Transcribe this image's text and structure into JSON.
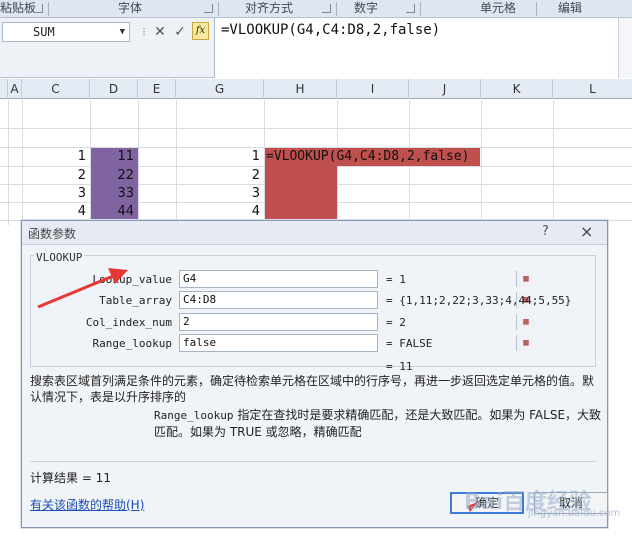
{
  "ribbon": {
    "groups": [
      "粘贴板",
      "字体",
      "对齐方式",
      "数字",
      "单元格",
      "编辑"
    ]
  },
  "formula_bar": {
    "name_box": "SUM",
    "fx_label": "fx",
    "formula": "=VLOOKUP(G4,C4:D8,2,false)"
  },
  "columns": [
    "A",
    "C",
    "D",
    "E",
    "G",
    "H",
    "I",
    "J",
    "K",
    "L"
  ],
  "sheet": {
    "c_values": [
      "1",
      "2",
      "3",
      "4"
    ],
    "d_values": [
      "11",
      "22",
      "33",
      "44"
    ],
    "g_values": [
      "1",
      "2",
      "3",
      "4"
    ],
    "h1_formula": "=VLOOKUP(G4,C4:D8,2,false)"
  },
  "dialog": {
    "title": "函数参数",
    "help_q": "?",
    "function_name": "VLOOKUP",
    "params": [
      {
        "label": "Lookup_value",
        "value": "G4",
        "result": "= 1"
      },
      {
        "label": "Table_array",
        "value": "C4:D8",
        "result": "= {1,11;2,22;3,33;4,44;5,55}"
      },
      {
        "label": "Col_index_num",
        "value": "2",
        "result": "= 2"
      },
      {
        "label": "Range_lookup",
        "value": "false",
        "result": "= FALSE"
      }
    ],
    "overall_result": "= 11",
    "description": "搜索表区域首列满足条件的元素，确定待检索单元格在区域中的行序号，再进一步返回选定单元格的值。默认情况下，表是以升序排序的",
    "param_desc_label": "Range_lookup",
    "param_desc": "指定在查找时是要求精确匹配，还是大致匹配。如果为 FALSE，大致匹配。如果为 TRUE 或忽略，精确匹配",
    "calc_result": "计算结果 = 11",
    "help_link": "有关该函数的帮助(H)",
    "ok_label": "确定",
    "cancel_label": "取消"
  },
  "watermark": "Bai百度经验",
  "watermark_sub": "jingyan.baidu.com",
  "colors": {
    "purple_fill": "#8064a2",
    "red_fill": "#c0504d",
    "arrow": "#e53935"
  }
}
